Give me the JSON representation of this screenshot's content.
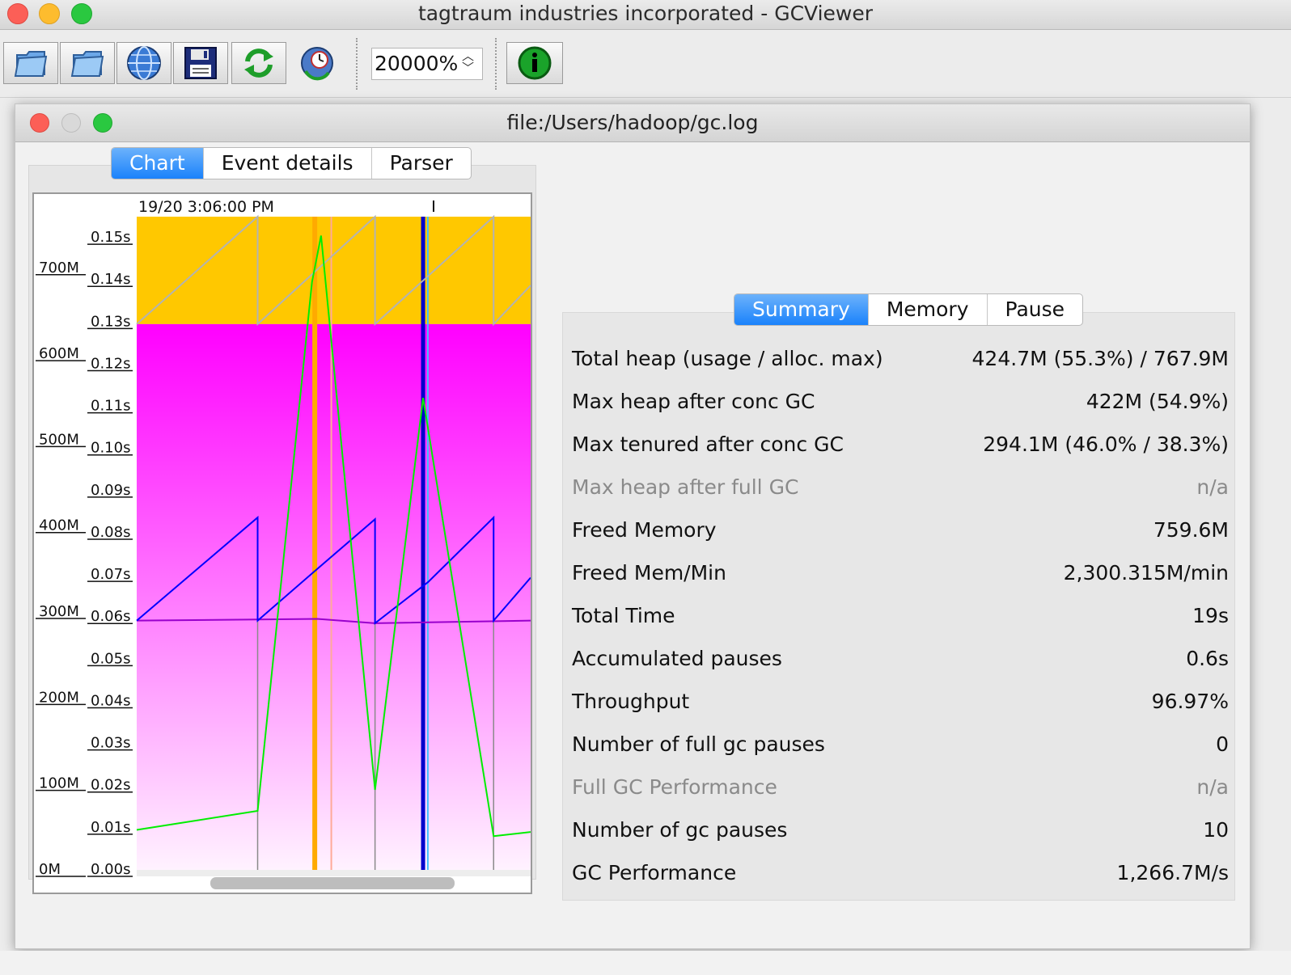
{
  "window": {
    "title": "tagtraum industries incorporated - GCViewer"
  },
  "toolbar": {
    "buttons": [
      {
        "name": "open-file-button",
        "icon": "folder-icon"
      },
      {
        "name": "open-file-button-2",
        "icon": "folder-icon"
      },
      {
        "name": "open-url-button",
        "icon": "globe-icon"
      },
      {
        "name": "export-button",
        "icon": "floppy-disk-icon"
      },
      {
        "name": "refresh-button",
        "icon": "refresh-icon"
      },
      {
        "name": "watch-button",
        "icon": "watch-globe-icon"
      }
    ],
    "zoom": "20000%",
    "info_icon": "info-icon"
  },
  "document": {
    "title": "file:/Users/hadoop/gc.log",
    "tabs": [
      "Chart",
      "Event details",
      "Parser"
    ],
    "active_tab": "Chart"
  },
  "chart_data": {
    "type": "line",
    "timestamp_label": "19/20 3:06:00 PM",
    "left_axis": {
      "ticks": [
        "700M",
        "600M",
        "500M",
        "400M",
        "300M",
        "200M",
        "100M",
        "0M"
      ],
      "range": [
        0,
        760
      ]
    },
    "right_axis": {
      "ticks": [
        "0.15s",
        "0.14s",
        "0.13s",
        "0.12s",
        "0.11s",
        "0.10s",
        "0.09s",
        "0.08s",
        "0.07s",
        "0.06s",
        "0.05s",
        "0.04s",
        "0.03s",
        "0.02s",
        "0.01s",
        "0.00s"
      ],
      "range": [
        0,
        0.155
      ]
    },
    "x_range": [
      0,
      100
    ],
    "colors": {
      "total_heap": "#ffc800",
      "tenured_heap": "#ff00ff",
      "young_usage": "#0000ff",
      "tenured_usage": "#9900cc",
      "gc_pause": "#00ee00",
      "max_heap_line": "#b3b3b3",
      "concurrent": "#ffaa00",
      "full_gc_marker": "#0000cc"
    },
    "series": [
      {
        "name": "total heap",
        "x": [
          0,
          100
        ],
        "y": [
          760,
          760
        ]
      },
      {
        "name": "tenured heap",
        "x": [
          0,
          100
        ],
        "y": [
          635,
          635
        ]
      },
      {
        "name": "young usage",
        "x": [
          0,
          30.7,
          30.7,
          45.8,
          60.5,
          60.5,
          74.0,
          90.6,
          90.6,
          100
        ],
        "y": [
          290,
          410,
          290,
          350,
          408,
          287,
          335,
          410,
          290,
          340
        ]
      },
      {
        "name": "tenured usage",
        "x": [
          0,
          45.8,
          60.5,
          100
        ],
        "y": [
          290,
          292,
          287,
          290
        ]
      },
      {
        "name": "max heap line",
        "x": [
          0,
          30.7,
          30.7,
          60.5,
          60.5,
          90.6,
          90.6,
          100
        ],
        "y": [
          635,
          760,
          635,
          760,
          635,
          760,
          635,
          680
        ]
      },
      {
        "name": "gc pause",
        "x": [
          0,
          30.7,
          44.5,
          46.8,
          60.5,
          72.7,
          90.6,
          100
        ],
        "y": [
          0.0095,
          0.014,
          0.1395,
          0.1505,
          0.019,
          0.112,
          0.008,
          0.009
        ]
      }
    ],
    "markers": [
      {
        "x": 45.2,
        "type": "concurrent",
        "color": "#ffaa00"
      },
      {
        "x": 49.4,
        "type": "concurrent",
        "color": "#ffaa99"
      },
      {
        "x": 72.7,
        "type": "full_gc_marker",
        "color": "#0000cc"
      },
      {
        "x": 73.9,
        "type": "concurrent",
        "color": "#40c0ff"
      }
    ]
  },
  "summary": {
    "tabs": [
      "Summary",
      "Memory",
      "Pause"
    ],
    "active_tab": "Summary",
    "rows": [
      {
        "key": "Total heap (usage / alloc. max)",
        "value": "424.7M (55.3%) / 767.9M",
        "enabled": true
      },
      {
        "key": "Max heap after conc GC",
        "value": "422M (54.9%)",
        "enabled": true
      },
      {
        "key": "Max tenured after conc GC",
        "value": "294.1M (46.0% / 38.3%)",
        "enabled": true
      },
      {
        "key": "Max heap after full GC",
        "value": "n/a",
        "enabled": false
      },
      {
        "key": "Freed Memory",
        "value": "759.6M",
        "enabled": true
      },
      {
        "key": "Freed Mem/Min",
        "value": "2,300.315M/min",
        "enabled": true
      },
      {
        "key": "Total Time",
        "value": "19s",
        "enabled": true
      },
      {
        "key": "Accumulated pauses",
        "value": "0.6s",
        "enabled": true
      },
      {
        "key": "Throughput",
        "value": "96.97%",
        "enabled": true
      },
      {
        "key": "Number of full gc pauses",
        "value": "0",
        "enabled": true
      },
      {
        "key": "Full GC Performance",
        "value": "n/a",
        "enabled": false
      },
      {
        "key": "Number of gc pauses",
        "value": "10",
        "enabled": true
      },
      {
        "key": "GC Performance",
        "value": "1,266.7M/s",
        "enabled": true
      }
    ]
  }
}
